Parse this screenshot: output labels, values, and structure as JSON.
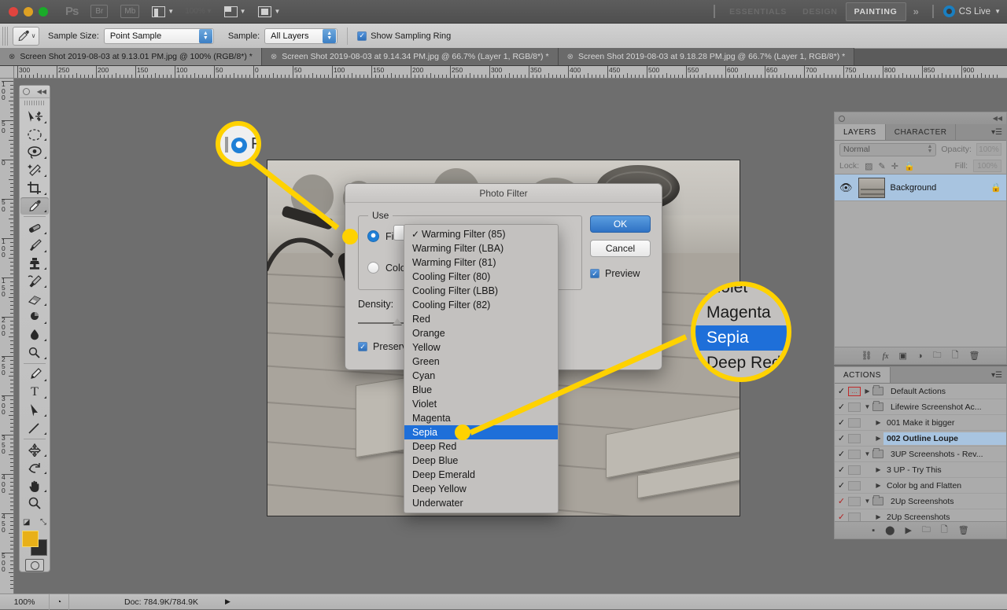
{
  "titlebar": {
    "ps_label": "Ps",
    "icons": [
      "bridge-icon",
      "mini-bridge-icon",
      "view-extras-icon",
      "zoom-level-icon",
      "screen-mode-icon",
      "arrange-documents-icon"
    ],
    "bridge_label": "Br",
    "minibridge_label": "Mb",
    "workspaces": [
      {
        "label": "ESSENTIALS",
        "active": false
      },
      {
        "label": "DESIGN",
        "active": false
      },
      {
        "label": "PAINTING",
        "active": true
      }
    ],
    "more_label": "»",
    "cslive_label": "CS Live"
  },
  "options_bar": {
    "tool_icon": "eyedropper-icon",
    "sample_size_label": "Sample Size:",
    "sample_size_value": "Point Sample",
    "sample_label": "Sample:",
    "sample_value": "All Layers",
    "show_sampling_ring_label": "Show Sampling Ring",
    "show_sampling_ring_checked": true
  },
  "tabs": [
    {
      "title": "Screen Shot 2019-08-03 at 9.13.01 PM.jpg @ 100% (RGB/8*) *",
      "active": true
    },
    {
      "title": "Screen Shot 2019-08-03 at 9.14.34 PM.jpg @ 66.7% (Layer 1, RGB/8*) *",
      "active": false
    },
    {
      "title": "Screen Shot 2019-08-03 at 9.18.28 PM.jpg @ 66.7% (Layer 1, RGB/8*) *",
      "active": false
    }
  ],
  "rulers": {
    "horizontal_labels": [
      "300",
      "250",
      "200",
      "150",
      "100",
      "50",
      "0",
      "50",
      "100",
      "150",
      "200",
      "250",
      "300",
      "350",
      "400",
      "450",
      "500",
      "550",
      "600",
      "650",
      "700",
      "750",
      "800",
      "850",
      "900"
    ],
    "vertical_labels": [
      "100",
      "50",
      "0",
      "50",
      "100",
      "150",
      "200",
      "250",
      "300",
      "350",
      "400",
      "450",
      "500"
    ]
  },
  "toolbox": {
    "tools": [
      {
        "name": "move-tool",
        "selected": false
      },
      {
        "name": "marquee-tool",
        "selected": false
      },
      {
        "name": "lasso-tool",
        "selected": false
      },
      {
        "name": "magic-wand-tool",
        "selected": false
      },
      {
        "name": "crop-tool",
        "selected": false
      },
      {
        "name": "eyedropper-tool",
        "selected": true
      },
      {
        "name": "healing-brush-tool",
        "selected": false
      },
      {
        "name": "brush-tool",
        "selected": false
      },
      {
        "name": "clone-stamp-tool",
        "selected": false
      },
      {
        "name": "history-brush-tool",
        "selected": false
      },
      {
        "name": "eraser-tool",
        "selected": false
      },
      {
        "name": "gradient-tool",
        "selected": false
      },
      {
        "name": "blur-tool",
        "selected": false
      },
      {
        "name": "dodge-tool",
        "selected": false
      },
      {
        "name": "pen-tool",
        "selected": false
      },
      {
        "name": "type-tool",
        "selected": false
      },
      {
        "name": "path-selection-tool",
        "selected": false
      },
      {
        "name": "line-tool",
        "selected": false
      },
      {
        "name": "three-d-tool",
        "selected": false
      },
      {
        "name": "rotate-view-tool",
        "selected": false
      },
      {
        "name": "hand-tool",
        "selected": false
      },
      {
        "name": "zoom-tool",
        "selected": false
      }
    ],
    "type_glyph": "T",
    "foreground_color": "#e8b018",
    "background_color": "#2d2d2d"
  },
  "dialog": {
    "title": "Photo Filter",
    "group_label": "Use",
    "filter_label": "Filter:",
    "filter_selected": true,
    "color_label": "Color:",
    "color_selected": false,
    "density_label": "Density:",
    "preserve_label": "Preserve",
    "preserve_checked": true,
    "ok_label": "OK",
    "cancel_label": "Cancel",
    "preview_label": "Preview",
    "preview_checked": true
  },
  "dropdown": {
    "items": [
      {
        "label": "Warming Filter (85)",
        "checked": true,
        "selected": false
      },
      {
        "label": "Warming Filter (LBA)",
        "checked": false,
        "selected": false
      },
      {
        "label": "Warming Filter (81)",
        "checked": false,
        "selected": false
      },
      {
        "label": "Cooling Filter (80)",
        "checked": false,
        "selected": false
      },
      {
        "label": "Cooling Filter (LBB)",
        "checked": false,
        "selected": false
      },
      {
        "label": "Cooling Filter (82)",
        "checked": false,
        "selected": false
      },
      {
        "label": "Red",
        "checked": false,
        "selected": false
      },
      {
        "label": "Orange",
        "checked": false,
        "selected": false
      },
      {
        "label": "Yellow",
        "checked": false,
        "selected": false
      },
      {
        "label": "Green",
        "checked": false,
        "selected": false
      },
      {
        "label": "Cyan",
        "checked": false,
        "selected": false
      },
      {
        "label": "Blue",
        "checked": false,
        "selected": false
      },
      {
        "label": "Violet",
        "checked": false,
        "selected": false
      },
      {
        "label": "Magenta",
        "checked": false,
        "selected": false
      },
      {
        "label": "Sepia",
        "checked": false,
        "selected": true
      },
      {
        "label": "Deep Red",
        "checked": false,
        "selected": false
      },
      {
        "label": "Deep Blue",
        "checked": false,
        "selected": false
      },
      {
        "label": "Deep Emerald",
        "checked": false,
        "selected": false
      },
      {
        "label": "Deep Yellow",
        "checked": false,
        "selected": false
      },
      {
        "label": "Underwater",
        "checked": false,
        "selected": false
      }
    ]
  },
  "loupes": {
    "filter_radio": {
      "target": "filter-radio-button"
    },
    "sepia_item": {
      "lines": [
        "Violet",
        "Magenta",
        "Sepia",
        "Deep Red",
        "Deep Blue"
      ],
      "selected_index": 2
    }
  },
  "layers_panel": {
    "tabs": [
      {
        "label": "LAYERS",
        "active": true
      },
      {
        "label": "CHARACTER",
        "active": false
      }
    ],
    "blend_mode": "Normal",
    "opacity_label": "Opacity:",
    "opacity_value": "100%",
    "lock_label": "Lock:",
    "fill_label": "Fill:",
    "fill_value": "100%",
    "lock_icons": [
      "lock-transparent-icon",
      "lock-paint-icon",
      "lock-position-icon",
      "lock-all-icon"
    ],
    "layers": [
      {
        "name": "Background",
        "visible": true,
        "locked": true,
        "selected": true
      }
    ],
    "footer_icons": [
      "link-layers-icon",
      "add-style-icon",
      "add-mask-icon",
      "adjustment-layer-icon",
      "new-group-icon",
      "new-layer-icon",
      "delete-layer-icon"
    ],
    "fx_label": "fx"
  },
  "actions_panel": {
    "tab_label": "ACTIONS",
    "rows": [
      {
        "label": "Default Actions",
        "checked": true,
        "box": "red",
        "type": "folder",
        "expanded": false,
        "indent": 0,
        "selected": false
      },
      {
        "label": "Lifewire Screenshot Ac...",
        "checked": true,
        "box": "empty",
        "type": "folder",
        "expanded": true,
        "indent": 0,
        "selected": false
      },
      {
        "label": "001 Make it bigger",
        "checked": true,
        "box": "empty",
        "type": "action",
        "expanded": false,
        "indent": 1,
        "selected": false
      },
      {
        "label": "002 Outline Loupe",
        "checked": true,
        "box": "empty",
        "type": "action",
        "expanded": false,
        "indent": 1,
        "selected": true
      },
      {
        "label": "3UP Screenshots - Rev...",
        "checked": true,
        "box": "empty",
        "type": "folder",
        "expanded": true,
        "indent": 0,
        "selected": false
      },
      {
        "label": "3 UP - Try This",
        "checked": true,
        "box": "empty",
        "type": "action",
        "expanded": false,
        "indent": 1,
        "selected": false
      },
      {
        "label": "Color bg and Flatten",
        "checked": true,
        "box": "empty",
        "type": "action",
        "expanded": false,
        "indent": 1,
        "selected": false
      },
      {
        "label": "2Up Screenshots",
        "checked": true,
        "checked_red": true,
        "box": "empty",
        "type": "folder",
        "expanded": true,
        "indent": 0,
        "selected": false
      },
      {
        "label": "2Up Screenshots",
        "checked": true,
        "checked_red": true,
        "box": "empty",
        "type": "action",
        "expanded": false,
        "indent": 1,
        "selected": false
      }
    ],
    "footer_icons": [
      "stop-icon",
      "record-icon",
      "play-icon",
      "new-set-icon",
      "new-action-icon",
      "delete-action-icon"
    ],
    "check_glyph": "✓",
    "expand_glyph": "▶",
    "collapse_glyph": "▼"
  },
  "status_bar": {
    "zoom": "100%",
    "doc_info": "Doc: 784.9K/784.9K",
    "arrow_glyph": "▶"
  },
  "colors": {
    "accent_blue": "#1e6fd9",
    "callout_yellow": "#ffd200",
    "panel_gray": "#ababab",
    "dialog_gray": "#c8c6c4"
  }
}
